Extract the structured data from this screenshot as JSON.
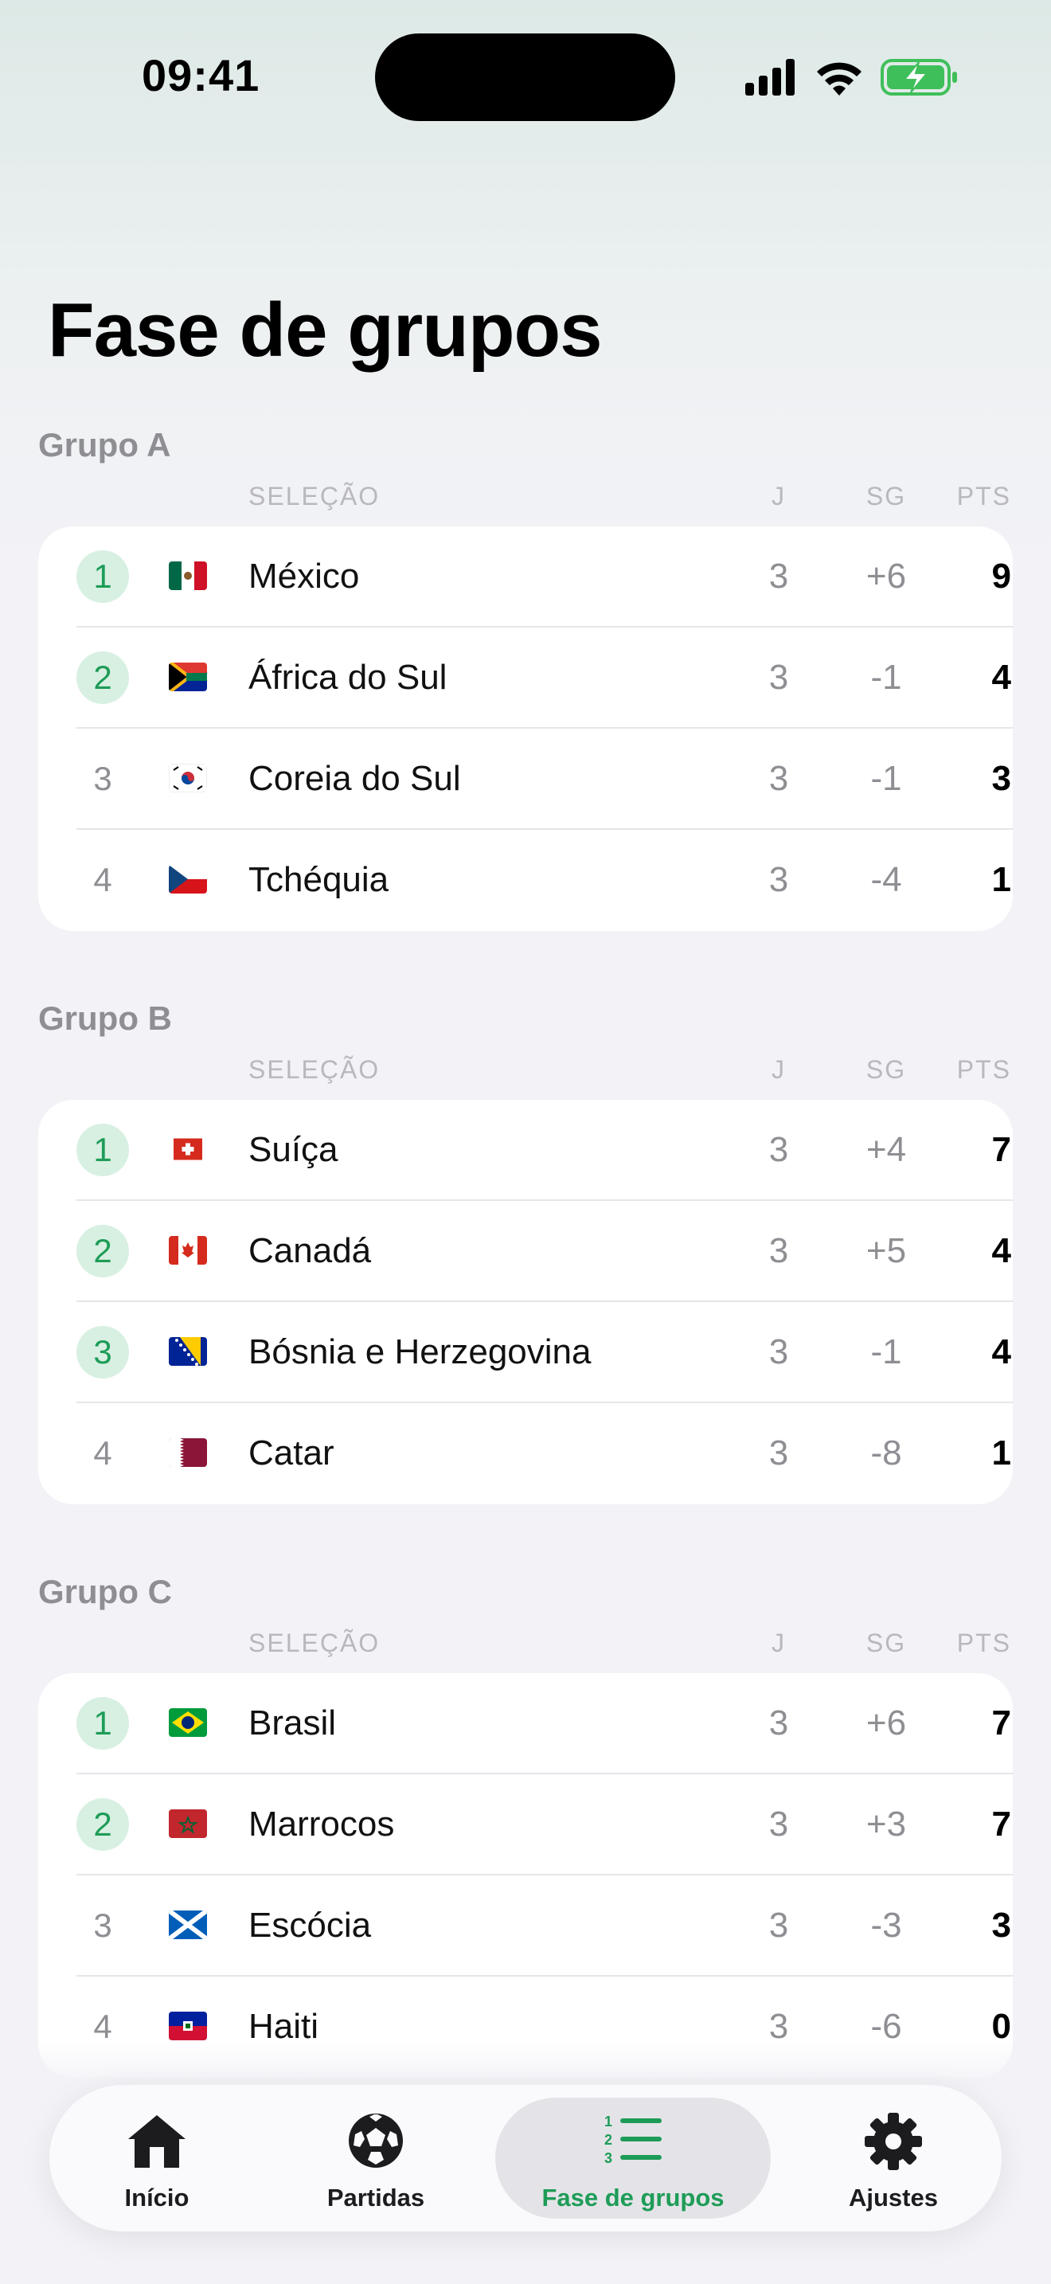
{
  "status_bar": {
    "time": "09:41"
  },
  "page_title": "Fase de grupos",
  "columns": {
    "team": "SELEÇÃO",
    "played": "J",
    "goal_diff": "SG",
    "points": "PTS"
  },
  "groups": [
    {
      "title": "Grupo A",
      "rows": [
        {
          "pos": "1",
          "team": "México",
          "played": "3",
          "gd": "+6",
          "pts": "9",
          "qualified": true,
          "flag": "mexico-flag"
        },
        {
          "pos": "2",
          "team": "África do Sul",
          "played": "3",
          "gd": "-1",
          "pts": "4",
          "qualified": true,
          "flag": "south-africa-flag"
        },
        {
          "pos": "3",
          "team": "Coreia do Sul",
          "played": "3",
          "gd": "-1",
          "pts": "3",
          "qualified": false,
          "flag": "south-korea-flag"
        },
        {
          "pos": "4",
          "team": "Tchéquia",
          "played": "3",
          "gd": "-4",
          "pts": "1",
          "qualified": false,
          "flag": "czechia-flag"
        }
      ]
    },
    {
      "title": "Grupo B",
      "rows": [
        {
          "pos": "1",
          "team": "Suíça",
          "played": "3",
          "gd": "+4",
          "pts": "7",
          "qualified": true,
          "flag": "switzerland-flag"
        },
        {
          "pos": "2",
          "team": "Canadá",
          "played": "3",
          "gd": "+5",
          "pts": "4",
          "qualified": true,
          "flag": "canada-flag"
        },
        {
          "pos": "3",
          "team": "Bósnia e Herzegovina",
          "played": "3",
          "gd": "-1",
          "pts": "4",
          "qualified": true,
          "flag": "bosnia-flag"
        },
        {
          "pos": "4",
          "team": "Catar",
          "played": "3",
          "gd": "-8",
          "pts": "1",
          "qualified": false,
          "flag": "qatar-flag"
        }
      ]
    },
    {
      "title": "Grupo C",
      "rows": [
        {
          "pos": "1",
          "team": "Brasil",
          "played": "3",
          "gd": "+6",
          "pts": "7",
          "qualified": true,
          "flag": "brazil-flag"
        },
        {
          "pos": "2",
          "team": "Marrocos",
          "played": "3",
          "gd": "+3",
          "pts": "7",
          "qualified": true,
          "flag": "morocco-flag"
        },
        {
          "pos": "3",
          "team": "Escócia",
          "played": "3",
          "gd": "-3",
          "pts": "3",
          "qualified": false,
          "flag": "scotland-flag"
        },
        {
          "pos": "4",
          "team": "Haiti",
          "played": "3",
          "gd": "-6",
          "pts": "0",
          "qualified": false,
          "flag": "haiti-flag"
        }
      ]
    }
  ],
  "tabs": [
    {
      "label": "Início",
      "icon": "house-icon",
      "active": false
    },
    {
      "label": "Partidas",
      "icon": "soccer-ball-icon",
      "active": false
    },
    {
      "label": "Fase de grupos",
      "icon": "ranked-list-icon",
      "active": true
    },
    {
      "label": "Ajustes",
      "icon": "gear-icon",
      "active": false
    }
  ],
  "colors": {
    "accent": "#1e9c57",
    "qualified_bg": "#d7f0e2",
    "muted": "#8e8e93",
    "background": "#f2f2f7"
  }
}
